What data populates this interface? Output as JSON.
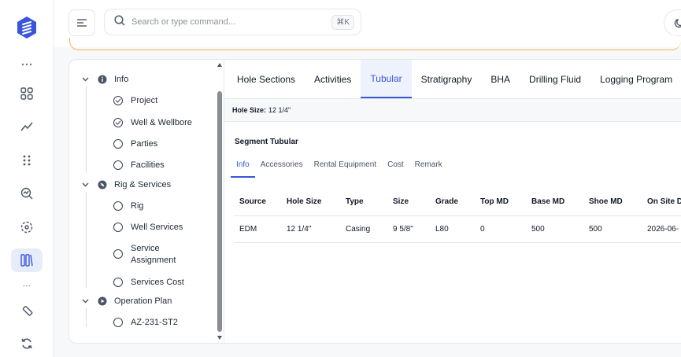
{
  "search": {
    "placeholder": "Search or type command...",
    "shortcut": "⌘K"
  },
  "tree": {
    "groups": [
      {
        "label": "Info",
        "children": [
          {
            "label": "Project",
            "checked": true
          },
          {
            "label": "Well & Wellbore",
            "checked": true
          },
          {
            "label": "Parties",
            "checked": false
          },
          {
            "label": "Facilities",
            "checked": false
          }
        ]
      },
      {
        "label": "Rig & Services",
        "children": [
          {
            "label": "Rig",
            "checked": false
          },
          {
            "label": "Well Services",
            "checked": false
          },
          {
            "label": "Service Assignment",
            "checked": false
          },
          {
            "label": "Services Cost",
            "checked": false
          }
        ]
      },
      {
        "label": "Operation Plan",
        "children": [
          {
            "label": "AZ-231-ST2",
            "checked": false
          }
        ]
      }
    ]
  },
  "tabs": [
    "Hole Sections",
    "Activities",
    "Tubular",
    "Stratigraphy",
    "BHA",
    "Drilling Fluid",
    "Logging Program"
  ],
  "active_tab": "Tubular",
  "hole_size": {
    "label": "Hole Size:",
    "value": "12 1/4\""
  },
  "segment": {
    "title": "Segment Tubular",
    "subtabs": [
      "Info",
      "Accessories",
      "Rental Equipment",
      "Cost",
      "Remark"
    ],
    "active_subtab": "Info"
  },
  "table": {
    "columns": [
      "Source",
      "Hole Size",
      "Type",
      "Size",
      "Grade",
      "Top MD",
      "Base MD",
      "Shoe MD",
      "On Site D"
    ],
    "rows": [
      [
        "EDM",
        "12 1/4\"",
        "Casing",
        "9 5/8\"",
        "L80",
        "0",
        "500",
        "500",
        "2026-06-"
      ]
    ]
  },
  "colors": {
    "accent": "#3a55d9",
    "warning_border": "#f4b45b",
    "active_tab_bg": "#eef2fc"
  }
}
